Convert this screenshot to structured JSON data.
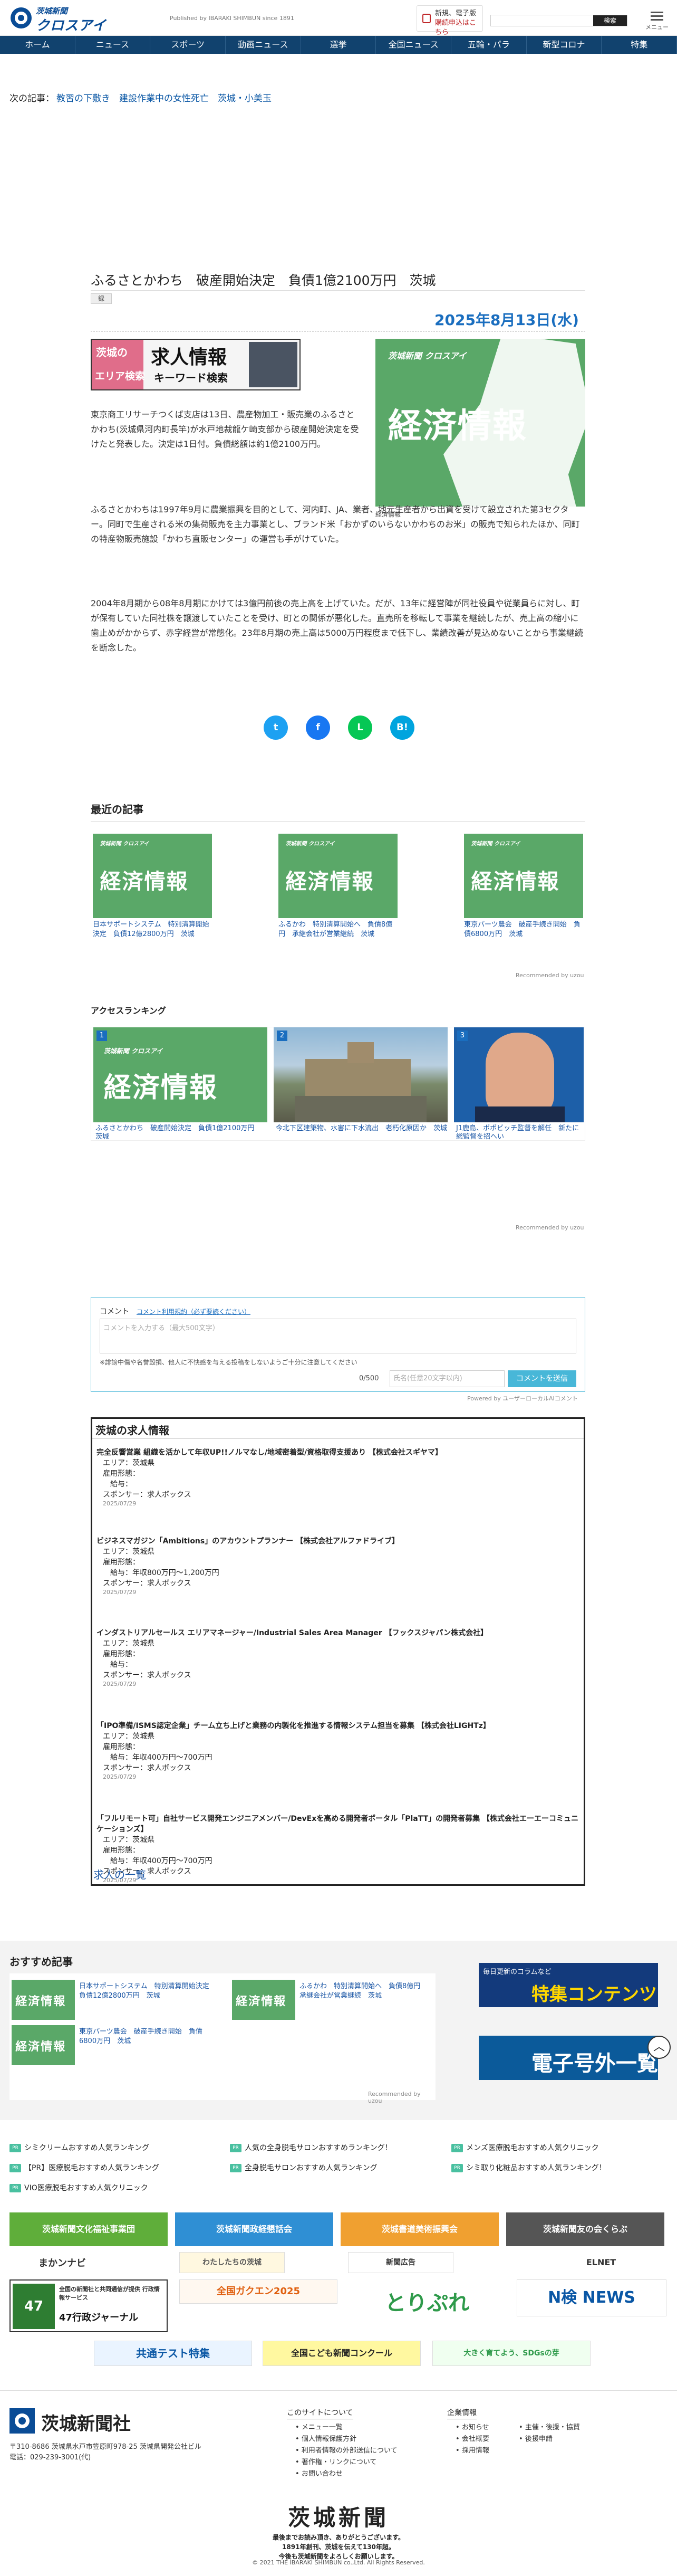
{
  "header": {
    "logo_small": "茨城新聞",
    "logo_main": "クロスアイ",
    "published": "Published by IBARAKI SHIMBUN since 1891",
    "register_line1": "新規、電子版",
    "register_line2": "購読申込はこちら",
    "search_button": "検索",
    "menu_label": "メニュー"
  },
  "nav": [
    "ホーム",
    "ニュース",
    "スポーツ",
    "動画ニュース",
    "選挙",
    "全国ニュース",
    "五輪・パラ",
    "新型コロナ",
    "特集"
  ],
  "next_article": {
    "label": "次の記事：",
    "link": "教習の下敷き　建設作業中の女性死亡　茨城・小美玉"
  },
  "article": {
    "title": "ふるさとかわち　破産開始決定　負債1億2100万円　茨城",
    "cam_tag": "録",
    "date": "2025年8月13日(水)",
    "image_caption": "経済情報",
    "paragraphs": [
      "東京商工リサーチつくば支店は13日、農産物加工・販売業のふるさとかわち(茨城県河内町長竿)が水戸地裁龍ケ崎支部から破産開始決定を受けたと発表した。決定は1日付。負債総額は約1億2100万円。",
      "ふるさとかわちは1997年9月に農業振興を目的として、河内町、JA、業者、地元生産者から出資を受けて設立された第3セクター。同町で生産される米の集荷販売を主力事業とし、ブランド米「おかずのいらないかわちのお米」の販売で知られたほか、同町の特産物販売施設「かわち直販センター」の運営も手がけていた。",
      "2004年8月期から08年8月期にかけては3億円前後の売上高を上げていた。だが、13年に経営陣が同社役員や従業員らに対し、町が保有していた同社株を譲渡していたことを受け、町との関係が悪化した。直売所を移転して事業を継続したが、売上高の縮小に歯止めがかからず、赤字経営が常態化。23年8月期の売上高は5000万円程度まで低下し、業績改善が見込めないことから事業継続を断念した。"
    ]
  },
  "job_banner": {
    "left1": "茨城の",
    "left2": "エリア検索",
    "right1": "求人情報",
    "right2": "キーワード検索"
  },
  "keizai_brand": "茨城新聞 クロスアイ",
  "keizai_text": "経済情報",
  "share": {
    "twitter": "t",
    "facebook": "f",
    "line": "L",
    "hatena": "B!"
  },
  "recent": {
    "title": "最近の記事",
    "items": [
      "日本サポートシステム　特別清算開始決定　負債12億2800万円　茨城",
      "ふるかわ　特別清算開始へ　負債8億円　承継会社が営業継続　茨城",
      "東京パーツ農会　破産手続き開始　負債6800万円　茨城"
    ],
    "powered": "Recommended by uzou"
  },
  "ranking": {
    "title": "アクセスランキング",
    "items": [
      {
        "num": "1",
        "caption": "ふるさとかわち　破産開始決定　負債1億2100万円　茨城"
      },
      {
        "num": "2",
        "caption": "今北下区建築物、水害に下水流出　老朽化原因か　茨城"
      },
      {
        "num": "3",
        "caption": "J1鹿島、ポポビッチ監督を解任　新たに総監督を招へい"
      }
    ],
    "powered": "Recommended by uzou"
  },
  "comment": {
    "label": "コメント",
    "rules_link": "コメント利用規約（必ず要読ください）",
    "placeholder": "コメントを入力する（最大500文字）",
    "warning": "※誹謗中傷や名誉毀損、他人に不快感を与える投稿をしないようご十分に注意してください",
    "count": "0/500",
    "nick_placeholder": "氏名(任意20文字以内)",
    "post": "コメントを送信",
    "powered": "Powered by ユーザーローカルAIコメント"
  },
  "jobs": {
    "title": "茨城の求人情報",
    "area_label": "エリア：",
    "type_label": "雇用形態：",
    "pay_label": "給与：",
    "sponsor_label": "スポンサー：",
    "items": [
      {
        "name": "完全反響営業 組織を活かして年収UP!!ノルマなし/地域密着型/資格取得支援あり 【株式会社スギヤマ】",
        "area": "茨城県",
        "type": "",
        "pay": "",
        "sponsor": "求人ボックス",
        "date": "2025/07/29"
      },
      {
        "name": "ビジネスマガジン「Ambitions」のアカウントプランナー 【株式会社アルファドライブ】",
        "area": "茨城県",
        "type": "",
        "pay": "年収800万円～1,200万円",
        "sponsor": "求人ボックス",
        "date": "2025/07/29"
      },
      {
        "name": "インダストリアルセールス エリアマネージャー/Industrial Sales Area Manager 【フックスジャパン株式会社】",
        "area": "茨城県",
        "type": "",
        "pay": "",
        "sponsor": "求人ボックス",
        "date": "2025/07/29"
      },
      {
        "name": "「IPO準備/ISMS認定企業」チーム立ち上げと業務の内製化を推進する情報システム担当を募集 【株式会社LIGHTz】",
        "area": "茨城県",
        "type": "",
        "pay": "年収400万円～700万円",
        "sponsor": "求人ボックス",
        "date": "2025/07/29"
      },
      {
        "name": "「フルリモート可」自社サービス開発エンジニアメンバー/DevExを高める開発者ポータル「PlaTT」の開発者募集 【株式会社エーエーコミュニケーションズ】",
        "area": "茨城県",
        "type": "",
        "pay": "年収400万円～700万円",
        "sponsor": "求人ボックス",
        "date": "2025/07/29"
      }
    ],
    "more": "求人の一覧"
  },
  "recommended": {
    "title": "おすすめ記事",
    "items": [
      "日本サポートシステム　特別清算開始決定　負債12億2800万円　茨城",
      "ふるかわ　特別清算開始へ　負債8億円　承継会社が営業継続　茨城",
      "東京パーツ農会　破産手続き開始　負債6800万円　茨城"
    ],
    "powered": "Recommended by uzou",
    "special_small": "毎日更新のコラムなど",
    "special_big": "特集コンテンツ",
    "digital_big": "電子号外一覧"
  },
  "pr_links": [
    "シミクリームおすすめ人気ランキング",
    "人気の全身脱毛サロンおすすめランキング！",
    "メンズ医療脱毛おすすめ人気クリニック",
    "【PR】医療脱毛おすすめ人気ランキング",
    "全身脱毛サロンおすすめ人気ランキング",
    "シミ取り化粧品おすすめ人気ランキング！",
    "VIO医療脱毛おすすめ人気クリニック"
  ],
  "orgs": [
    {
      "label": "茨城新聞文化福祉事業団",
      "color": "#5fae3a"
    },
    {
      "label": "茨城新聞政経懇話会",
      "color": "#2f8fd4"
    },
    {
      "label": "茨城書道美術振興会",
      "color": "#f0a030"
    },
    {
      "label": "茨城新聞友の会くらぶ",
      "color": "#555555"
    }
  ],
  "banners": {
    "makanavi": "まかンナビ",
    "kaba": "わたしたちの茨城",
    "gakushu": "新聞広告",
    "elnet": "ELNET",
    "gyosei1": "47行政ジャーナル",
    "gyosei2": "全国の新聞社と共同通信が提供 行政情報サービス",
    "zenkoku": "全国ガクエン2025",
    "toripure": "とりぷれ",
    "ken": "N検 NEWS",
    "kyotsu": "共通テスト特集",
    "kodomo": "全国こども新聞コンクール",
    "sdgs": "大きく育てよう、SDGsの芽"
  },
  "footer": {
    "name": "茨城新聞社",
    "addr1": "〒310-8686 茨城県水戸市笠原町978-25 茨城県開発公社ビル",
    "addr2": "電話：029-239-3001(代)",
    "site_head": "このサイトについて",
    "site_links": [
      "メニュー一覧",
      "個人情報保護方針",
      "利用者情報の外部送信について",
      "著作権・リンクについて",
      "お問い合わせ"
    ],
    "corp_head": "企業情報",
    "corp_links": [
      "お知らせ",
      "会社概要",
      "採用情報",
      "主催・後援・協賛",
      "後援申請"
    ],
    "big": "茨城新聞",
    "msg1": "最後までお読み頂き、ありがとうございます。",
    "msg2": "1891年創刊、茨城を伝えて130年超。",
    "msg3": "今後も茨城新聞をよろしくお願いします。",
    "copy": "© 2021 THE IBARAKI SHIMBUN co.,Ltd. All Rights Reserved."
  },
  "colors": {
    "nav": "#11426e",
    "accent": "#1a6ebf",
    "keizai": "#5aa868"
  }
}
